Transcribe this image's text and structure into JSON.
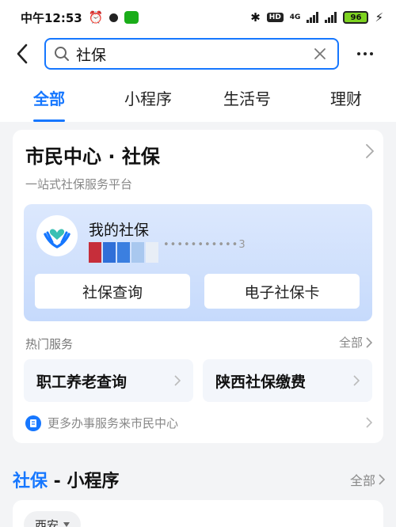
{
  "status_bar": {
    "time": "中午12:53",
    "network": "4G",
    "hd": "HD",
    "battery": "96"
  },
  "search": {
    "value": "社保"
  },
  "tabs": [
    {
      "label": "全部",
      "active": true
    },
    {
      "label": "小程序",
      "active": false
    },
    {
      "label": "生活号",
      "active": false
    },
    {
      "label": "理财",
      "active": false
    }
  ],
  "card": {
    "title": "市民中心 · 社保",
    "subtitle": "一站式社保服务平台",
    "my_ss": "我的社保",
    "masked_id": "•••••••••••3",
    "btn_query": "社保查询",
    "btn_card": "电子社保卡",
    "hot_label": "热门服务",
    "hot_all": "全部",
    "svc1": "职工养老查询",
    "svc2": "陕西社保缴费",
    "more": "更多办事服务来市民中心"
  },
  "section": {
    "title_blue": "社保",
    "title_rest": " - 小程序",
    "all": "全部"
  },
  "region": "西安",
  "colors": {
    "accent": "#1677ff",
    "strip": [
      "#c62e3a",
      "#2f6fd8",
      "#3b7fe0",
      "#a9c8ef",
      "#e8eef6"
    ]
  }
}
